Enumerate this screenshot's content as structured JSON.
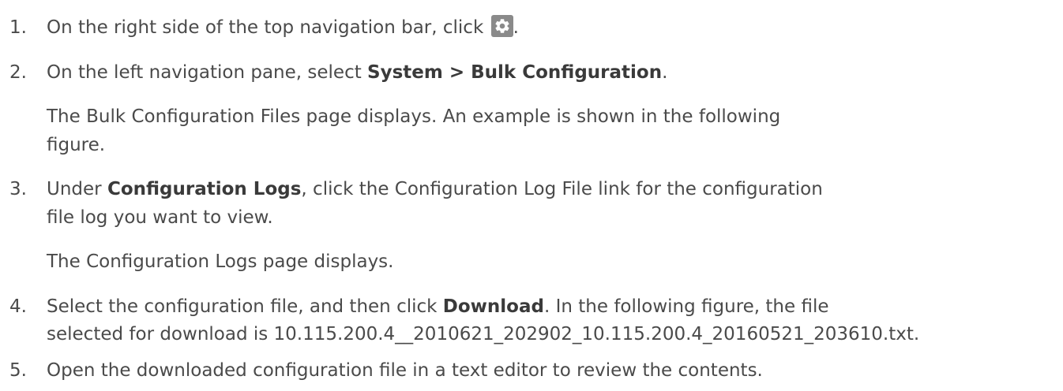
{
  "steps": [
    {
      "number": "1.",
      "before_icon": "On the right side of the top navigation bar, click ",
      "icon": "gear-icon",
      "after_icon": "."
    },
    {
      "number": "2.",
      "text_before": "On the left navigation pane, select ",
      "bold": "System > Bulk Configuration",
      "text_after": ".",
      "result_line1": "The Bulk Configuration Files page displays. An example is shown in the following",
      "result_line2": "figure."
    },
    {
      "number": "3.",
      "text_before": "Under ",
      "bold": "Configuration Logs",
      "text_after": ", click the Configuration Log File link for the configuration",
      "line2": "file log you want to view.",
      "result": "The Configuration Logs page displays."
    },
    {
      "number": "4.",
      "text_before": "Select the configuration file, and then click ",
      "bold": "Download",
      "text_after": ". In the following figure, the file",
      "line2": "selected for download is 10.115.200.4__2010621_202902_10.115.200.4_20160521_203610.txt."
    },
    {
      "number": "5.",
      "text": "Open the downloaded configuration file in a text editor to review the contents."
    }
  ]
}
